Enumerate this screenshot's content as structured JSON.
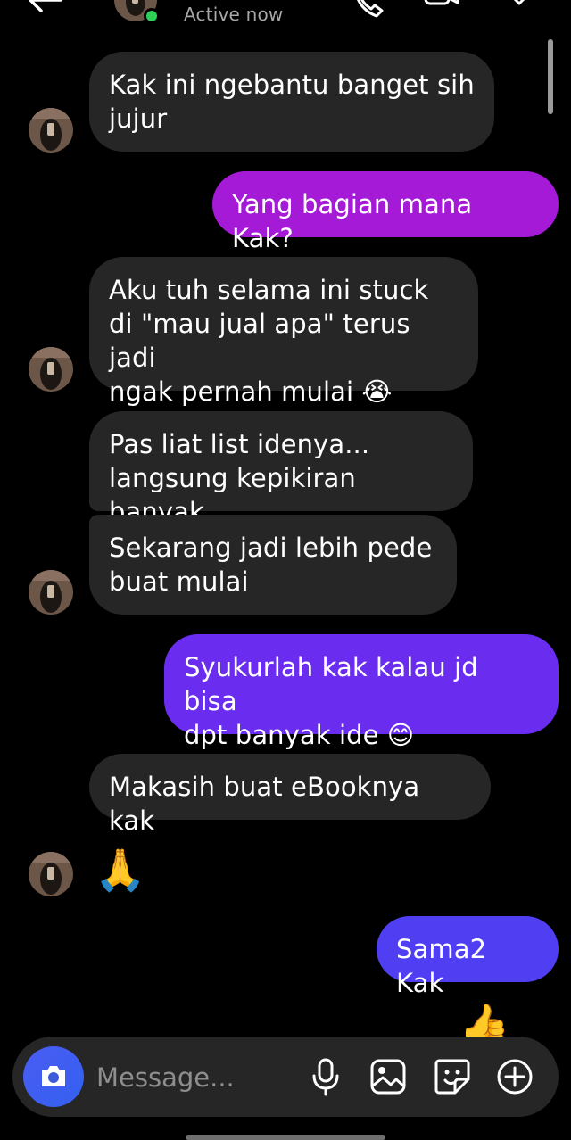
{
  "header": {
    "status": "Active now"
  },
  "messages": [
    {
      "side": "in",
      "text": "Kak ini ngebantu banget sih\njujur"
    },
    {
      "side": "out",
      "text": "Yang bagian mana Kak?"
    },
    {
      "side": "in",
      "text": "Aku tuh selama ini stuck\ndi \"mau jual apa\" terus jadi\nngak pernah mulai 😭"
    },
    {
      "side": "in",
      "text": "Pas liat list idenya...\nlangsung kepikiran banyak"
    },
    {
      "side": "in",
      "text": "Sekarang jadi lebih pede\nbuat mulai"
    },
    {
      "side": "out",
      "text": "Syukurlah kak kalau jd bisa\ndpt banyak ide 😊"
    },
    {
      "side": "in",
      "text": "Makasih buat eBooknya kak"
    },
    {
      "side": "in",
      "text": "🙏"
    },
    {
      "side": "out",
      "text": "Sama2 Kak"
    },
    {
      "side": "out",
      "text": "👍"
    }
  ],
  "composer": {
    "placeholder": "Message..."
  },
  "colors": {
    "background": "#000000",
    "incoming_bubble": "#262626",
    "outgoing_magenta": "#a41ad6",
    "outgoing_violet": "#6a2df0",
    "outgoing_blue": "#4f3ef2",
    "camera_button": "#3b5bdb",
    "online_dot": "#2ed158"
  },
  "icons": [
    "back-arrow-icon",
    "phone-icon",
    "video-camera-icon",
    "tag-icon",
    "camera-icon",
    "microphone-icon",
    "gallery-icon",
    "sticker-icon",
    "plus-circle-icon"
  ]
}
